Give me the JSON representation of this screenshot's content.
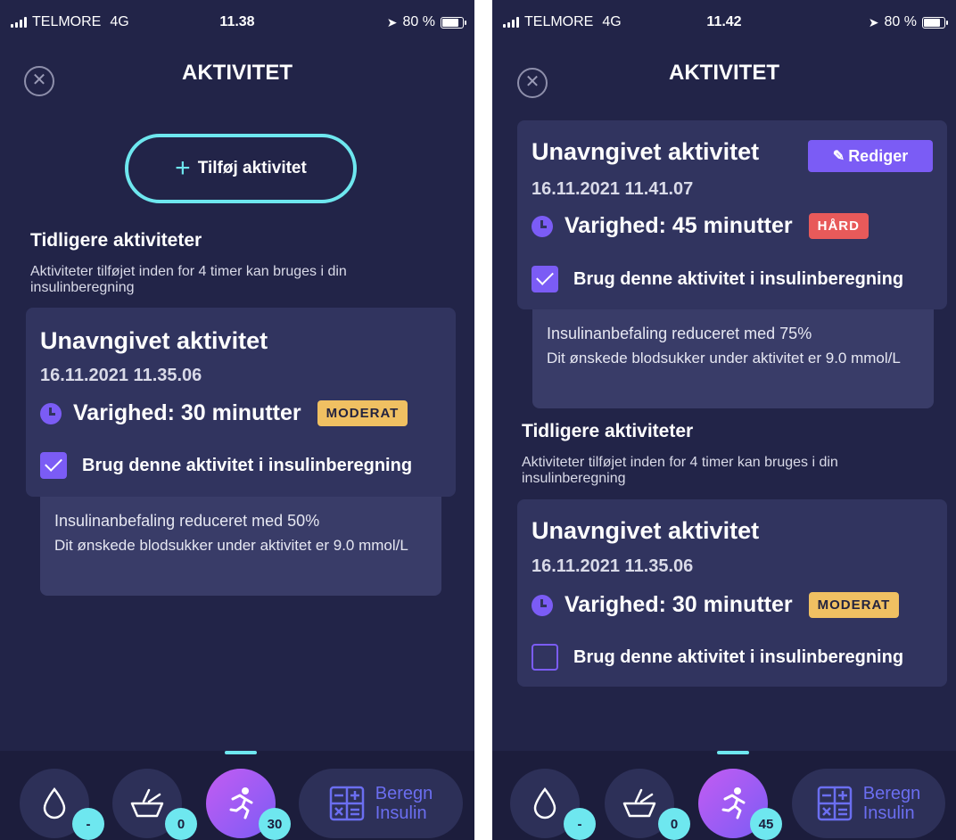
{
  "screens": [
    {
      "status": {
        "carrier": "TELMORE",
        "network": "4G",
        "time": "11.38",
        "battery": "80 %"
      },
      "title": "AKTIVITET",
      "add_button": "Tilføj aktivitet",
      "section": {
        "title": "Tidligere aktiviteter",
        "subtitle": "Aktiviteter tilføjet inden for 4 timer kan bruges i din insulinberegning"
      },
      "card": {
        "name": "Unavngivet aktivitet",
        "date": "16.11.2021 11.35.06",
        "duration": "Varighed: 30 minutter",
        "intensity": "MODERAT",
        "use_label": "Brug denne aktivitet i insulinberegning",
        "use_checked": true,
        "reduction": "Insulinanbefaling reduceret med 50%",
        "target": "Dit ønskede blodsukker under aktivitet er 9.0 mmol/L"
      },
      "nav": {
        "glucose_badge": "-",
        "carbs_badge": "0",
        "activity_badge": "30",
        "calc_label_1": "Beregn",
        "calc_label_2": "Insulin"
      }
    },
    {
      "status": {
        "carrier": "TELMORE",
        "network": "4G",
        "time": "11.42",
        "battery": "80 %"
      },
      "title": "AKTIVITET",
      "current": {
        "name": "Unavngivet aktivitet",
        "edit": "Rediger",
        "date": "16.11.2021 11.41.07",
        "duration": "Varighed: 45 minutter",
        "intensity": "HÅRD",
        "use_label": "Brug denne aktivitet i insulinberegning",
        "use_checked": true,
        "reduction": "Insulinanbefaling reduceret med 75%",
        "target": "Dit ønskede blodsukker under aktivitet er 9.0 mmol/L"
      },
      "section": {
        "title": "Tidligere aktiviteter",
        "subtitle": "Aktiviteter tilføjet inden for 4 timer kan bruges i din insulinberegning"
      },
      "previous": {
        "name": "Unavngivet aktivitet",
        "date": "16.11.2021 11.35.06",
        "duration": "Varighed: 30 minutter",
        "intensity": "MODERAT",
        "use_label": "Brug denne aktivitet i insulinberegning",
        "use_checked": false
      },
      "nav": {
        "glucose_badge": "-",
        "carbs_badge": "0",
        "activity_badge": "45",
        "calc_label_1": "Beregn",
        "calc_label_2": "Insulin"
      }
    }
  ],
  "icons": [
    "signal-icon",
    "battery-icon",
    "close-icon",
    "plus-icon",
    "clock-icon",
    "checkbox-icon",
    "edit-icon",
    "drop-icon",
    "bowl-icon",
    "runner-icon",
    "calculator-icon"
  ],
  "colors": {
    "background": "#222448",
    "card": "#31345f",
    "accent_cyan": "#6ee7ef",
    "accent_purple": "#7b5cf5",
    "moderat": "#f0c062",
    "hard": "#e85a5a"
  }
}
